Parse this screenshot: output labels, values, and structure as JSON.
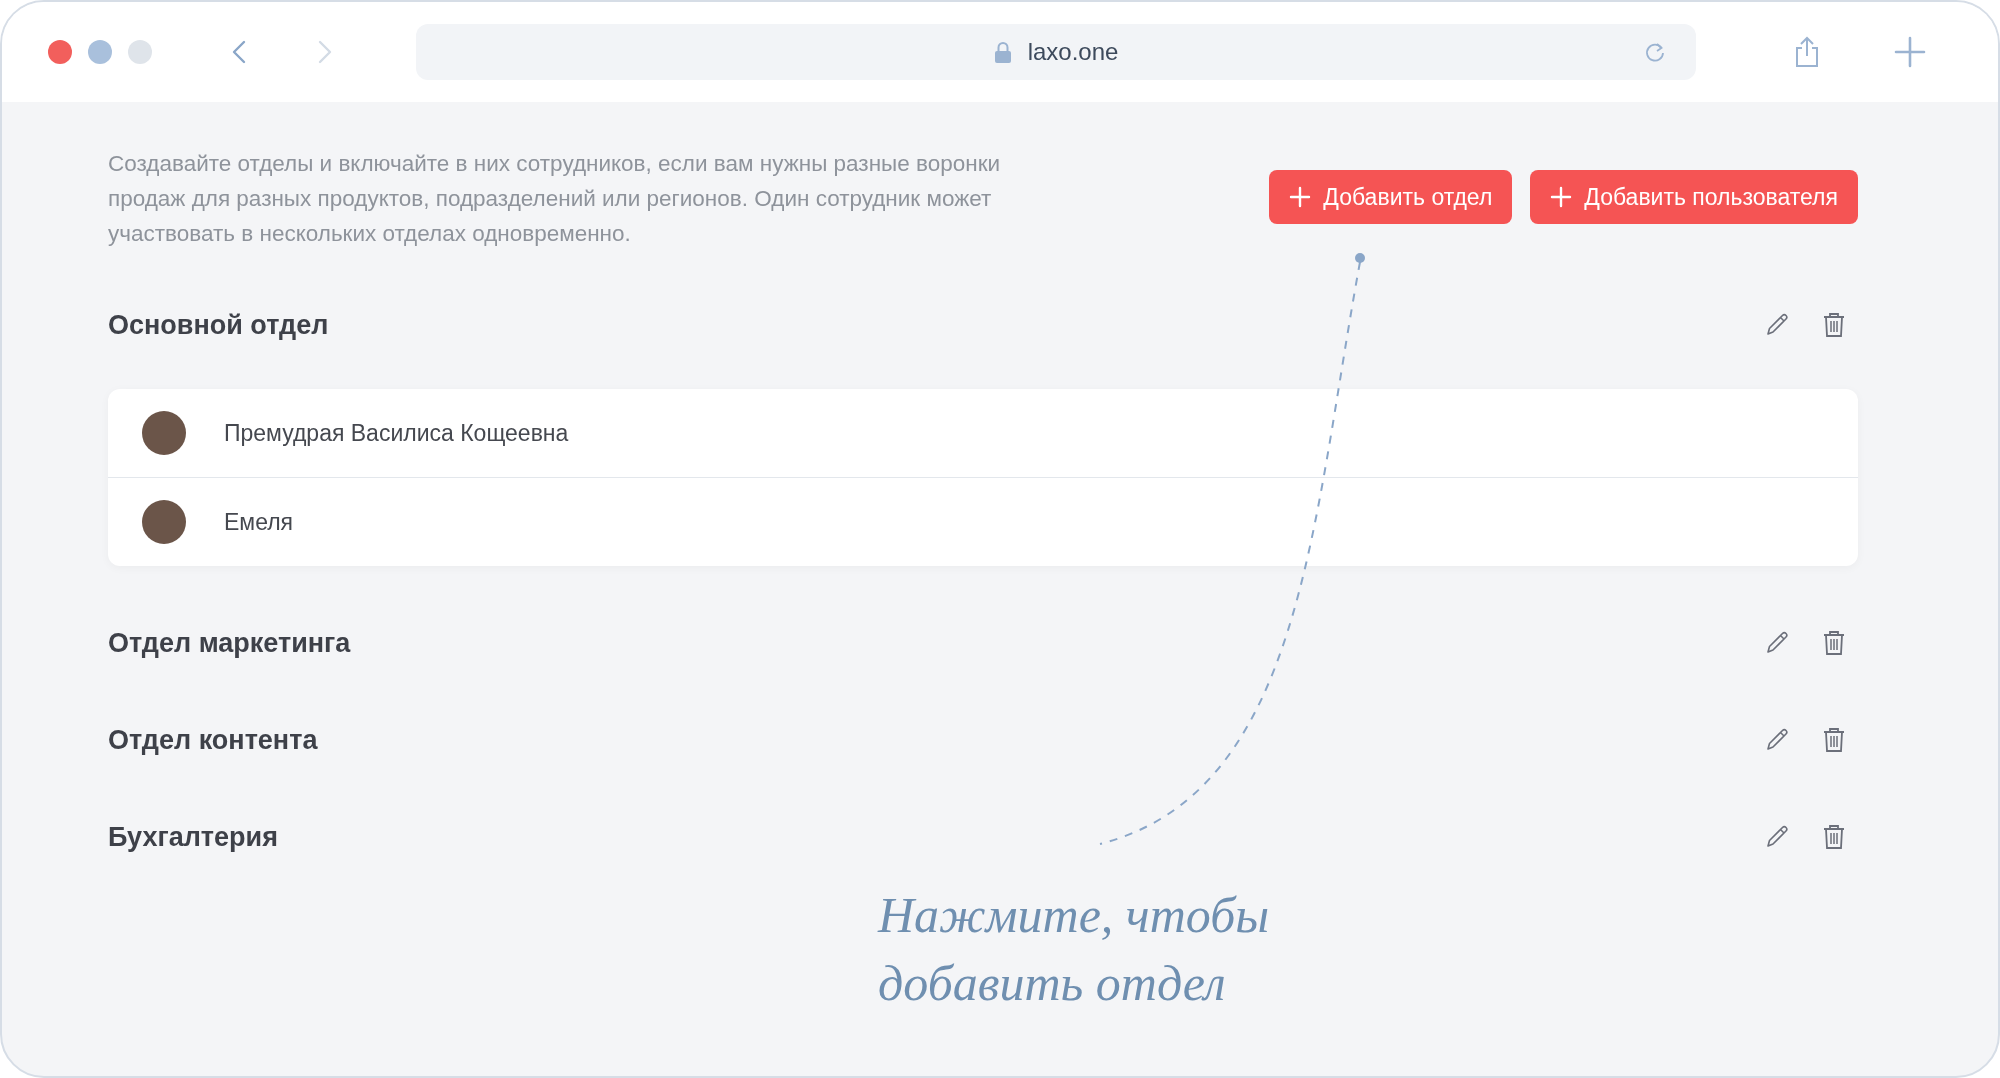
{
  "browser": {
    "url": "laxo.one",
    "nav": [
      {
        "kind": "back",
        "disabled": false
      },
      {
        "kind": "forward",
        "disabled": true
      }
    ]
  },
  "intro": "Создавайте отделы и включайте в них сотрудников, если вам нужны разные воронки продаж для разных продуктов, подразделений или регионов. Один сотрудник может участвовать в нескольких отделах одновременно.",
  "actions": [
    {
      "label": "Добавить отдел"
    },
    {
      "label": "Добавить пользователя"
    }
  ],
  "departments": [
    {
      "name": "Основной отдел",
      "members": [
        {
          "name": "Премудрая Василиса Кощеевна"
        },
        {
          "name": "Емеля"
        }
      ]
    },
    {
      "name": "Отдел маркетинга"
    },
    {
      "name": "Отдел контента"
    },
    {
      "name": "Бухгалтерия"
    }
  ],
  "annotation": "Нажмите, чтобы добавить отдел"
}
